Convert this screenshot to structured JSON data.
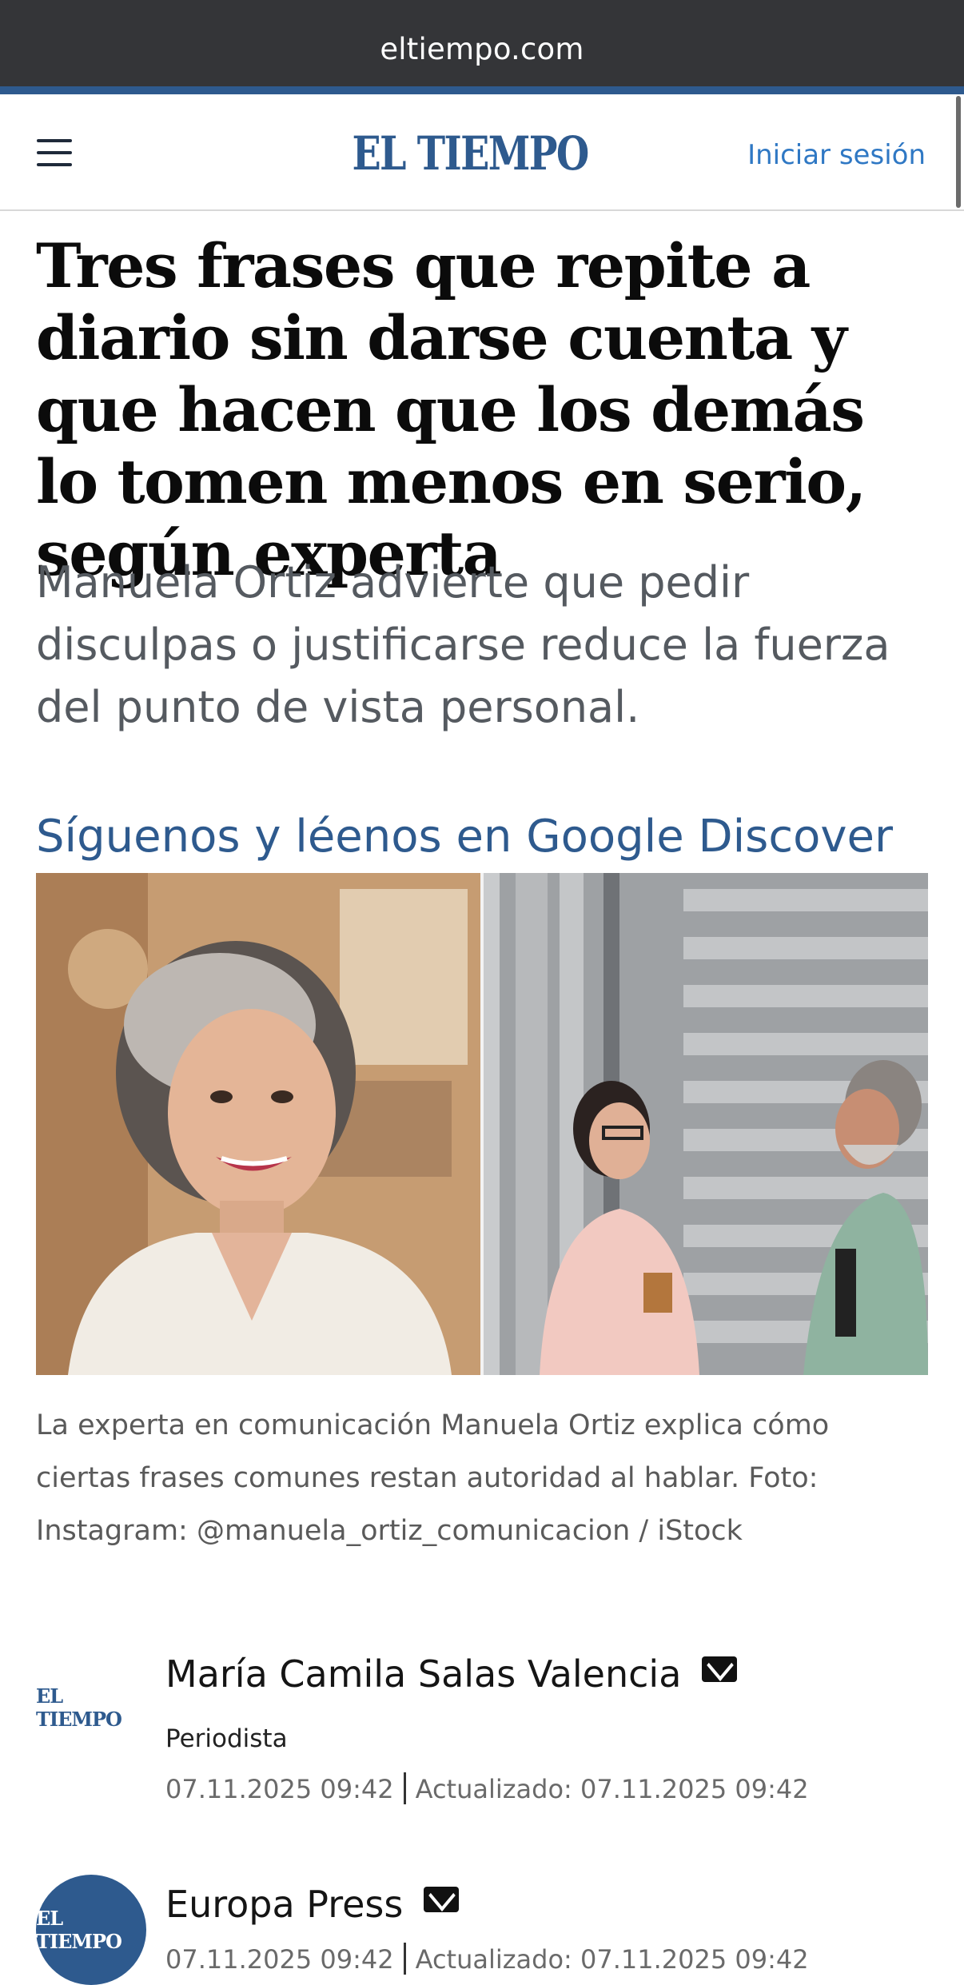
{
  "browser": {
    "url": "eltiempo.com"
  },
  "header": {
    "logo": "EL TIEMPO",
    "login_label": "Iniciar sesión"
  },
  "article": {
    "headline": "Tres frases que repite a diario sin darse cuenta y que hacen que los demás lo tomen menos en serio, según experta",
    "subtitle": "Manuela Ortiz advierte que pedir disculpas o justificarse reduce la fuerza del punto de vista personal.",
    "discover_link": "Síguenos y léenos en Google Discover",
    "caption": "La experta en comunicación Manuela Ortiz explica cómo ciertas frases comunes restan autoridad al hablar. Foto: Instagram: @manuela_ortiz_comunicacion / iStock"
  },
  "authors": [
    {
      "logo": "EL TIEMPO",
      "name": "María Camila Salas Valencia",
      "role": "Periodista",
      "published": "07.11.2025 09:42",
      "updated_label": "Actualizado:",
      "updated": "07.11.2025 09:42"
    },
    {
      "logo": "EL TIEMPO",
      "name": "Europa Press",
      "published": "07.11.2025 09:42",
      "updated_label": "Actualizado:",
      "updated": "07.11.2025 09:42"
    }
  ],
  "colors": {
    "brand": "#2e5a8e",
    "link": "#2f78c4",
    "urlbar": "#343538"
  }
}
